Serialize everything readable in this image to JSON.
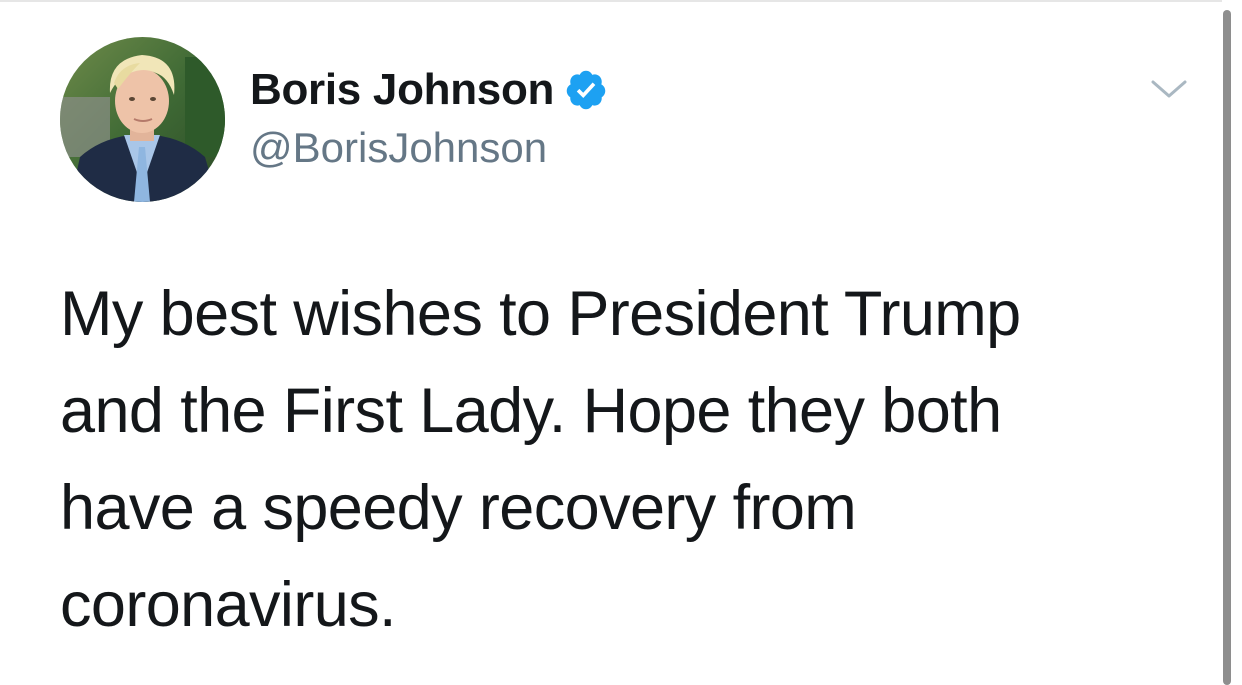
{
  "tweet": {
    "author": {
      "display_name": "Boris Johnson",
      "handle": "@BorisJohnson",
      "verified": true,
      "verified_icon": "verified-badge-icon",
      "avatar_icon": "profile-photo"
    },
    "text": "My best wishes to President Trump and the First Lady. Hope they both have a speedy recovery from coronavirus.",
    "menu_icon": "chevron-down-icon"
  },
  "colors": {
    "verified_blue": "#1DA1F2",
    "name": "#14171A",
    "handle": "#657786",
    "caret": "#AAB8C2",
    "background": "#FFFFFF",
    "scrollbar": "#8E8E8E"
  }
}
